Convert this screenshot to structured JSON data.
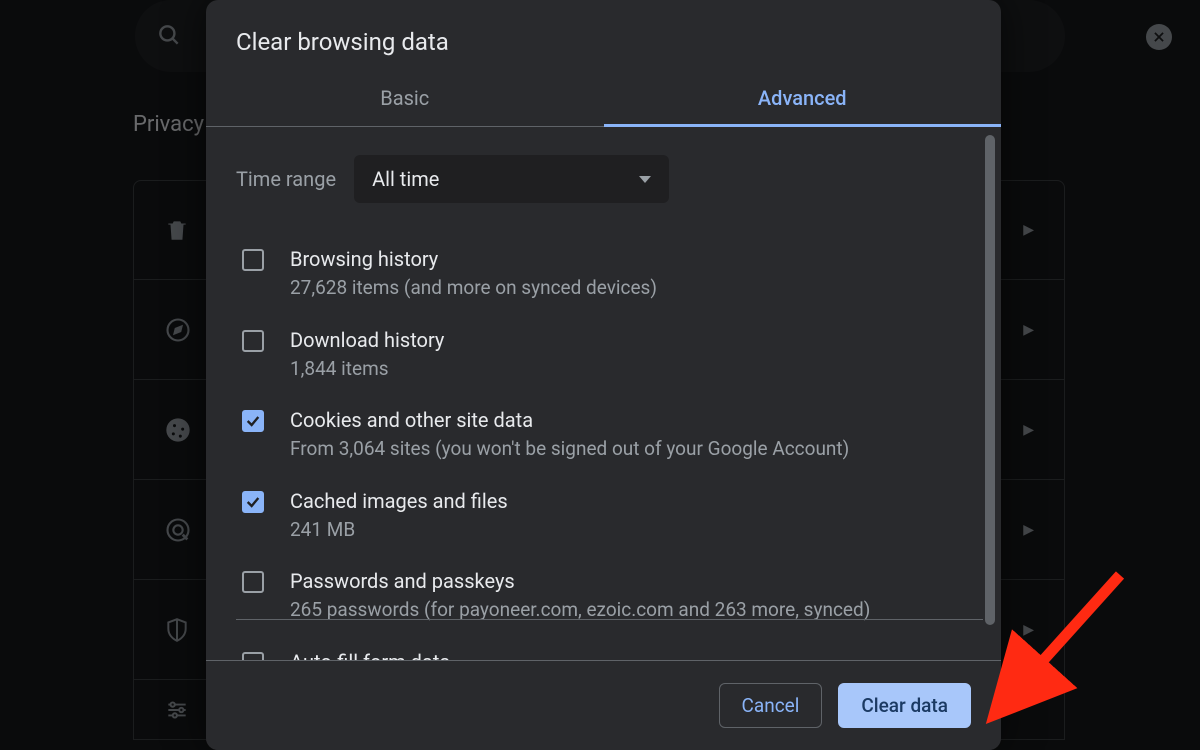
{
  "background": {
    "section_title": "Privacy"
  },
  "modal": {
    "title": "Clear browsing data",
    "tabs": {
      "basic": "Basic",
      "advanced": "Advanced"
    },
    "active_tab": "advanced",
    "time_range": {
      "label": "Time range",
      "value": "All time"
    },
    "items": [
      {
        "checked": false,
        "title": "Browsing history",
        "sub": "27,628 items (and more on synced devices)"
      },
      {
        "checked": false,
        "title": "Download history",
        "sub": "1,844 items"
      },
      {
        "checked": true,
        "title": "Cookies and other site data",
        "sub": "From 3,064 sites (you won't be signed out of your Google Account)"
      },
      {
        "checked": true,
        "title": "Cached images and files",
        "sub": "241 MB"
      },
      {
        "checked": false,
        "title": "Passwords and passkeys",
        "sub": "265 passwords (for payoneer.com, ezoic.com and 263 more, synced)"
      },
      {
        "checked": false,
        "title": "Auto-fill form data",
        "sub": ""
      }
    ],
    "buttons": {
      "cancel": "Cancel",
      "clear": "Clear data"
    }
  }
}
